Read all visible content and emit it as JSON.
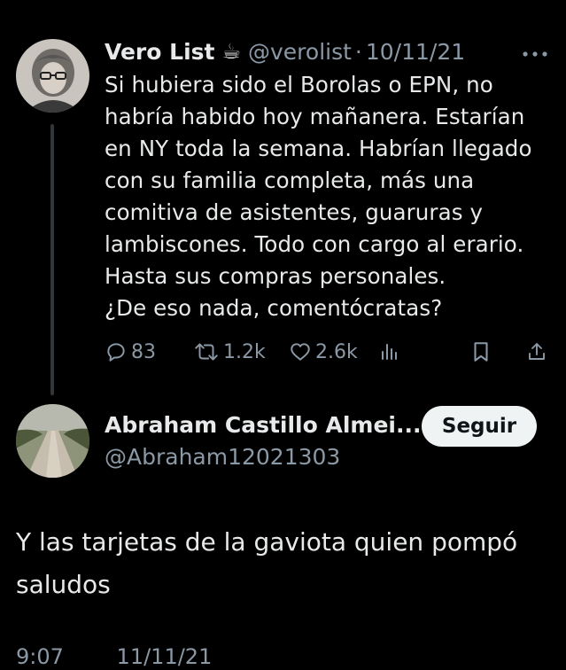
{
  "tweet": {
    "author_name": "Vero List",
    "author_emoji": "☕",
    "handle": "@verolist",
    "separator": "·",
    "date": "10/11/21",
    "lines": [
      "Si hubiera sido el Borolas o EPN, no",
      "habría habido hoy mañanera. Estarían",
      "en NY toda la semana. Habrían llegado",
      "con su familia completa, más una",
      "comitiva de asistentes, guaruras y",
      "lambiscones. Todo con cargo al erario.",
      "Hasta sus compras personales.",
      "¿De eso nada, comentócratas?"
    ],
    "replies": "83",
    "retweets": "1.2k",
    "likes": "2.6k"
  },
  "reply": {
    "author_name": "Abraham Castillo Almei...",
    "handle": "@Abraham12021303",
    "follow_label": "Seguir",
    "lines": [
      "Y las tarjetas de la gaviota quien pompó",
      "saludos"
    ],
    "time": "9:07",
    "date": "11/11/21"
  },
  "icons": {
    "more": "more-dots-icon",
    "reply": "reply-bubble-icon",
    "retweet": "retweet-icon",
    "like": "heart-icon",
    "views": "views-bars-icon",
    "bookmark": "bookmark-icon",
    "share": "share-icon"
  },
  "colors": {
    "background": "#000000",
    "primary_text": "#e7e9ea",
    "secondary_text": "#8b98a5",
    "thread_line": "#333639",
    "follow_button_bg": "#eff3f4",
    "follow_button_text": "#0f1419"
  }
}
